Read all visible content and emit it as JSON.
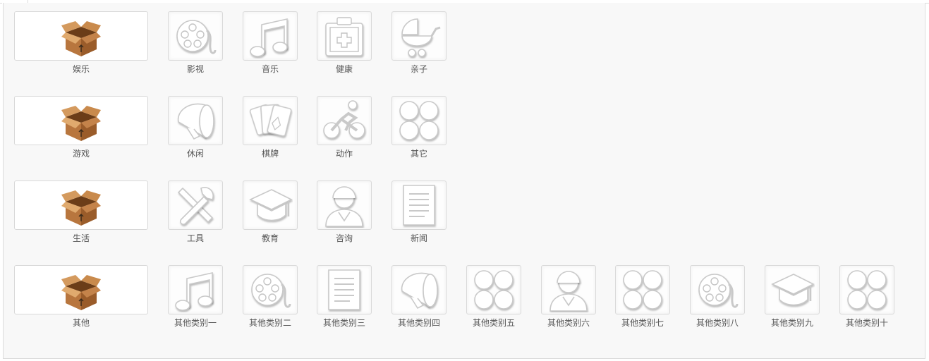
{
  "rows": [
    {
      "category": {
        "label": "娱乐",
        "icon": "package-icon"
      },
      "items": [
        {
          "label": "影视",
          "icon": "film-reel-icon"
        },
        {
          "label": "音乐",
          "icon": "music-note-icon"
        },
        {
          "label": "健康",
          "icon": "first-aid-kit-icon"
        },
        {
          "label": "亲子",
          "icon": "baby-stroller-icon"
        }
      ]
    },
    {
      "category": {
        "label": "游戏",
        "icon": "package-icon"
      },
      "items": [
        {
          "label": "休闲",
          "icon": "megaphone-icon"
        },
        {
          "label": "棋牌",
          "icon": "playing-cards-icon"
        },
        {
          "label": "动作",
          "icon": "cyclist-icon"
        },
        {
          "label": "其它",
          "icon": "four-circles-icon"
        }
      ]
    },
    {
      "category": {
        "label": "生活",
        "icon": "package-icon"
      },
      "items": [
        {
          "label": "工具",
          "icon": "tools-icon"
        },
        {
          "label": "教育",
          "icon": "graduation-cap-icon"
        },
        {
          "label": "咨询",
          "icon": "support-agent-icon"
        },
        {
          "label": "新闻",
          "icon": "document-icon"
        }
      ]
    },
    {
      "category": {
        "label": "其他",
        "icon": "package-icon"
      },
      "items": [
        {
          "label": "其他类别一",
          "icon": "music-note-icon"
        },
        {
          "label": "其他类别二",
          "icon": "film-reel-icon"
        },
        {
          "label": "其他类别三",
          "icon": "document-icon"
        },
        {
          "label": "其他类别四",
          "icon": "megaphone-icon"
        },
        {
          "label": "其他类别五",
          "icon": "four-circles-icon"
        },
        {
          "label": "其他类别六",
          "icon": "support-agent-icon"
        },
        {
          "label": "其他类别七",
          "icon": "four-circles-icon"
        },
        {
          "label": "其他类别八",
          "icon": "film-reel-icon"
        },
        {
          "label": "其他类别九",
          "icon": "graduation-cap-icon"
        },
        {
          "label": "其他类别十",
          "icon": "four-circles-icon"
        }
      ]
    }
  ]
}
